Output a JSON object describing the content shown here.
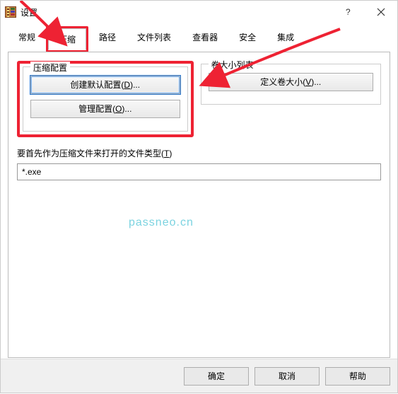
{
  "window": {
    "title": "设置"
  },
  "titlebar": {
    "help_icon": "?",
    "close_icon": "×"
  },
  "tabs": {
    "general": "常规",
    "compress": "压缩",
    "path": "路径",
    "filelist": "文件列表",
    "viewer": "查看器",
    "security": "安全",
    "integration": "集成"
  },
  "panel": {
    "groups": {
      "compress_profile": {
        "legend": "压缩配置",
        "create_default_prefix": "创建默认配置(",
        "create_default_key": "D",
        "create_default_suffix": ")...",
        "manage_prefix": "管理配置(",
        "manage_key": "O",
        "manage_suffix": ")..."
      },
      "volume_list": {
        "legend": "卷大小列表",
        "define_prefix": "定义卷大小(",
        "define_key": "V",
        "define_suffix": ")..."
      }
    },
    "filetype_label_prefix": "要首先作为压缩文件来打开的文件类型(",
    "filetype_label_key": "T",
    "filetype_label_suffix": ")",
    "filetype_value": "*.exe"
  },
  "buttons": {
    "ok": "确定",
    "cancel": "取消",
    "help": "帮助"
  },
  "watermark": "passneo.cn"
}
